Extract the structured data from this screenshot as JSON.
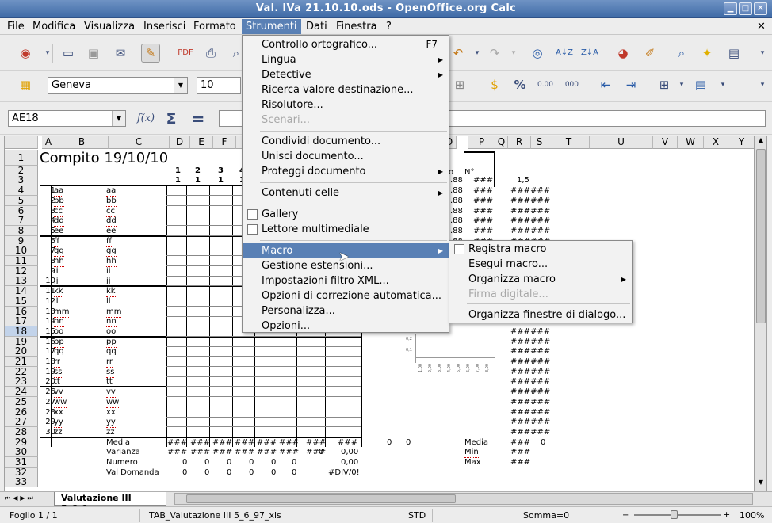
{
  "window": {
    "title": "Val. IVa 21.10.10.ods - OpenOffice.org Calc"
  },
  "menubar": [
    "File",
    "Modifica",
    "Visualizza",
    "Inserisci",
    "Formato",
    "Strumenti",
    "Dati",
    "Finestra",
    "?"
  ],
  "formatting": {
    "font_name": "Geneva",
    "font_size": "10"
  },
  "formula_bar": {
    "cell_ref": "AE18"
  },
  "sheet": {
    "col_headers": [
      [
        "A",
        47,
        17
      ],
      [
        "B",
        64,
        67
      ],
      [
        "C",
        131,
        77
      ],
      [
        "D",
        208,
        26
      ],
      [
        "E",
        234,
        29
      ],
      [
        "F",
        263,
        29
      ],
      [
        "G",
        292,
        26
      ],
      [
        "O",
        552,
        18
      ],
      [
        "P",
        585,
        34
      ],
      [
        "Q",
        619,
        16
      ],
      [
        "R",
        635,
        29
      ],
      [
        "S",
        664,
        22
      ],
      [
        "T",
        686,
        52
      ],
      [
        "U",
        738,
        80
      ],
      [
        "V",
        818,
        31
      ],
      [
        "W",
        849,
        33
      ],
      [
        "X",
        882,
        31
      ],
      [
        "Y",
        913,
        34
      ]
    ],
    "title": "Compito 19/10/10",
    "rows": [
      "1",
      "2",
      "3",
      "4",
      "5",
      "6",
      "7",
      "8",
      "9",
      "10",
      "11",
      "12",
      "13",
      "14",
      "15",
      "16",
      "17",
      "18",
      "19",
      "20",
      "21",
      "22",
      "23",
      "24",
      "25",
      "26",
      "27",
      "28",
      "29",
      "30",
      "31",
      "32",
      "33"
    ],
    "current_row": "18",
    "names": [
      [
        "1",
        "aa",
        "aa"
      ],
      [
        "2",
        "bb",
        "bb"
      ],
      [
        "3",
        "cc",
        "cc"
      ],
      [
        "4",
        "dd",
        "dd"
      ],
      [
        "5",
        "ee",
        "ee"
      ],
      [
        "6",
        "ff",
        "ff"
      ],
      [
        "7",
        "gg",
        "gg"
      ],
      [
        "8",
        "hh",
        "hh"
      ],
      [
        "9",
        "ii",
        "ii"
      ],
      [
        "10",
        "jj",
        "jj"
      ],
      [
        "11",
        "kk",
        "kk"
      ],
      [
        "12",
        "ll",
        "ll"
      ],
      [
        "13",
        "mm",
        "mm"
      ],
      [
        "14",
        "nn",
        "nn"
      ],
      [
        "15",
        "oo",
        "oo"
      ],
      [
        "16",
        "pp",
        "pp"
      ],
      [
        "17",
        "qq",
        "qq"
      ],
      [
        "18",
        "rr",
        "rr"
      ],
      [
        "19",
        "ss",
        "ss"
      ],
      [
        "20",
        "tt",
        "tt"
      ],
      [
        "26",
        "vv",
        "vv"
      ],
      [
        "27",
        "ww",
        "ww"
      ],
      [
        "28",
        "xx",
        "xx"
      ],
      [
        "29",
        "yy",
        "yy"
      ],
      [
        "30",
        "zz",
        "zz"
      ]
    ],
    "hash": "###",
    "hash6": "######",
    "qnum": [
      "1",
      "2",
      "3",
      "4"
    ],
    "qsub": [
      "1",
      "1",
      "1",
      "1"
    ],
    "o_col": [
      ".88",
      ".88",
      ".88",
      ".88",
      ".88",
      ".88",
      ".88"
    ],
    "r3": "1,5",
    "o_hdr": "o",
    "p_hdr": "N°",
    "stats": {
      "labels": [
        "Media",
        "Varianza",
        "Numero",
        "Val Domanda"
      ],
      "r30_extra": "0",
      "r30_val": "0,00",
      "r31_val": "0,00",
      "r32_val": "#DIV/0!",
      "r31_zeros": [
        "0",
        "0",
        "0",
        "0",
        "0",
        "0"
      ],
      "r32_zeros": [
        "0",
        "0",
        "0",
        "0",
        "0",
        "0"
      ],
      "r29_zeros": [
        "0",
        "0"
      ],
      "right_labels": [
        "Media",
        "Min",
        "Max"
      ],
      "right_media_val": "0"
    },
    "chart_y_ticks": [
      "0,2",
      "0,1"
    ],
    "chart_x_ticks": [
      "1,00",
      "2,00",
      "3,00",
      "4,00",
      "5,00",
      "6,00",
      "7,00",
      "8,00"
    ]
  },
  "menu_strumenti": {
    "items": [
      {
        "label": "Controllo ortografico...",
        "shortcut": "F7"
      },
      {
        "label": "Lingua",
        "sub": true
      },
      {
        "label": "Detective",
        "sub": true
      },
      {
        "label": "Ricerca valore destinazione..."
      },
      {
        "label": "Risolutore..."
      },
      {
        "label": "Scenari...",
        "disabled": true
      },
      {
        "label": "Condividi documento..."
      },
      {
        "label": "Unisci documento..."
      },
      {
        "label": "Proteggi documento",
        "sub": true
      },
      {
        "label": "Contenuti celle",
        "sub": true
      },
      {
        "label": "Gallery",
        "check": true
      },
      {
        "label": "Lettore multimediale",
        "check": true
      },
      {
        "label": "Macro",
        "sub": true,
        "highlight": true
      },
      {
        "label": "Gestione estensioni..."
      },
      {
        "label": "Impostazioni filtro XML..."
      },
      {
        "label": "Opzioni di correzione automatica..."
      },
      {
        "label": "Personalizza..."
      },
      {
        "label": "Opzioni..."
      }
    ]
  },
  "menu_macro": {
    "items": [
      {
        "label": "Registra macro",
        "check": true
      },
      {
        "label": "Esegui macro..."
      },
      {
        "label": "Organizza macro",
        "sub": true
      },
      {
        "label": "Firma digitale...",
        "disabled": true
      },
      {
        "label": "Organizza finestre di dialogo..."
      }
    ]
  },
  "tabs": {
    "active": "Valutazione III 5_6_9..."
  },
  "status": {
    "sheet": "Foglio 1 / 1",
    "style": "TAB_Valutazione III 5_6_97_xls",
    "mode": "STD",
    "sum": "Somma=0",
    "zoom": "100%"
  }
}
